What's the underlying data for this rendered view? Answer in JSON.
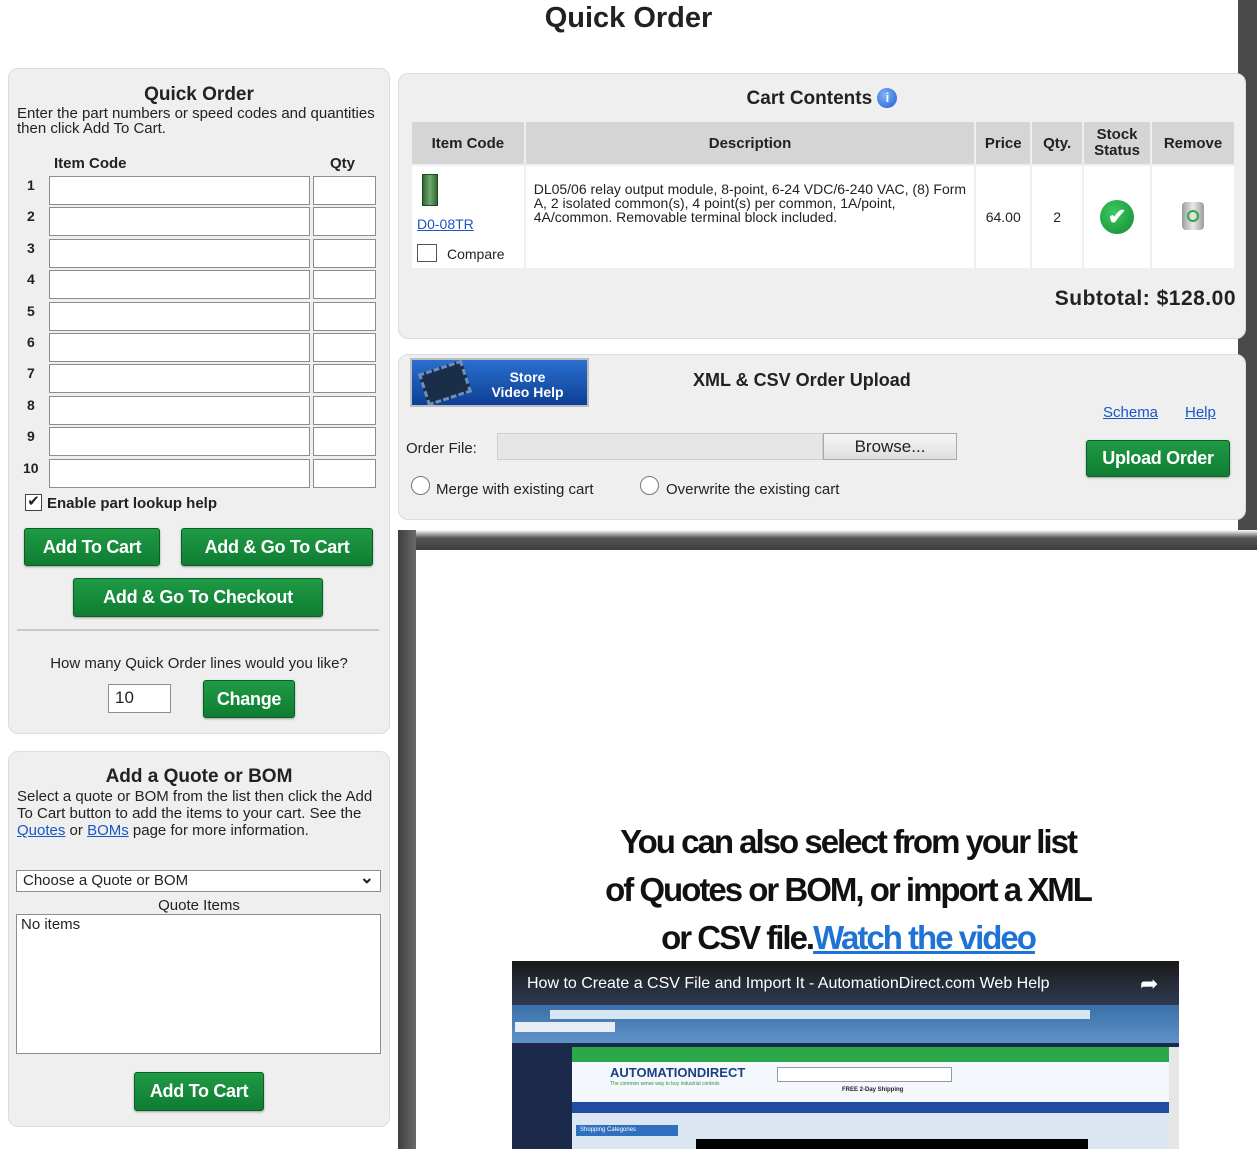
{
  "page_title": "Quick Order",
  "quick_order": {
    "title": "Quick Order",
    "instructions": "Enter the part numbers or speed codes and quantities then click Add To Cart.",
    "col_item_code": "Item Code",
    "col_qty": "Qty",
    "rows": [
      "1",
      "2",
      "3",
      "4",
      "5",
      "6",
      "7",
      "8",
      "9",
      "10"
    ],
    "lookup_label": "Enable part lookup help",
    "add_to_cart": "Add To Cart",
    "add_go_cart": "Add & Go To Cart",
    "add_go_checkout": "Add & Go To Checkout",
    "lines_question": "How many Quick Order lines would you like?",
    "lines_value": "10",
    "change_label": "Change"
  },
  "quote_bom": {
    "title": "Add a Quote or BOM",
    "text_1": "Select a quote or BOM from the list then click the Add To Cart button to add the items to your cart. See the",
    "quotes_link": "Quotes",
    "or_text": "or",
    "boms_link": "BOMs",
    "text_2": "page for more information.",
    "select_value": "Choose a Quote or BOM",
    "items_label": "Quote Items",
    "items_text": "No items",
    "add_to_cart": "Add To Cart"
  },
  "cart": {
    "title": "Cart Contents",
    "headers": {
      "item_code": "Item Code",
      "description": "Description",
      "price": "Price",
      "qty": "Qty.",
      "stock_1": "Stock",
      "stock_2": "Status",
      "remove": "Remove"
    },
    "item": {
      "code": "D0-08TR",
      "compare": "Compare",
      "description": "DL05/06 relay output module, 8-point, 6-24 VDC/6-240 VAC, (8) Form A, 2 isolated common(s), 4 point(s) per common, 1A/point, 4A/common. Removable terminal block included.",
      "price": "64.00",
      "qty": "2"
    },
    "subtotal": "Subtotal: $128.00"
  },
  "upload": {
    "video_help_1": "Store",
    "video_help_2": "Video Help",
    "title": "XML & CSV Order Upload",
    "schema_link": "Schema",
    "help_link": "Help",
    "order_file_label": "Order File:",
    "browse_label": "Browse...",
    "upload_button": "Upload Order",
    "merge_label": "Merge with existing cart",
    "overwrite_label": "Overwrite the existing cart"
  },
  "promo": {
    "line_1": "You can also select from your list",
    "line_2": "of Quotes or BOM, or import a XML",
    "line_3_prefix": "or CSV file.",
    "link": "Watch the video"
  },
  "video": {
    "title": "How to Create a CSV File and Import It - AutomationDirect.com Web Help",
    "brand": "AUTOMATIONDIRECT",
    "tagline": "The common sense way to buy industrial controls",
    "shipping": "FREE 2-Day Shipping",
    "category": "Shopping Categories"
  },
  "colors": {
    "green_button": "#139040",
    "panel_bg": "#efefef",
    "link": "#1a56c6",
    "shadow": "#4a4a4a"
  }
}
